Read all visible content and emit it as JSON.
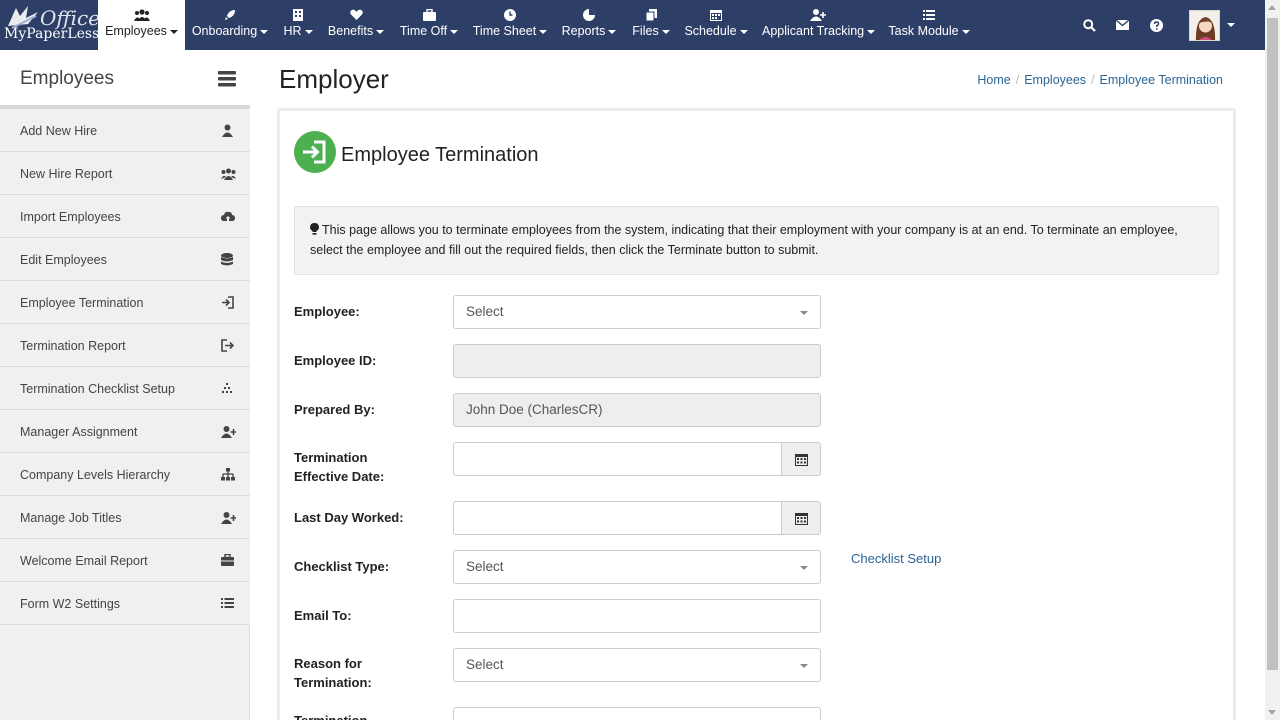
{
  "brand": {
    "line1": "Office",
    "line2": "MyPaperLess"
  },
  "nav": {
    "items": [
      {
        "label": "Employees",
        "icon": "users-icon"
      },
      {
        "label": "Onboarding",
        "icon": "rocket-icon"
      },
      {
        "label": "HR",
        "icon": "building-icon"
      },
      {
        "label": "Benefits",
        "icon": "heart-icon"
      },
      {
        "label": "Time Off",
        "icon": "briefcase-icon"
      },
      {
        "label": "Time Sheet",
        "icon": "clock-icon"
      },
      {
        "label": "Reports",
        "icon": "pie-chart-icon"
      },
      {
        "label": "Files",
        "icon": "files-icon"
      },
      {
        "label": "Schedule",
        "icon": "calendar-icon"
      },
      {
        "label": "Applicant Tracking",
        "icon": "user-plus-icon"
      },
      {
        "label": "Task Module",
        "icon": "list-icon"
      }
    ],
    "active_color": "#ffffff",
    "bar_color": "#2d3f66"
  },
  "sidebar": {
    "title": "Employees",
    "items": [
      {
        "label": "Add New Hire",
        "icon": "user-icon"
      },
      {
        "label": "New Hire Report",
        "icon": "users-icon"
      },
      {
        "label": "Import Employees",
        "icon": "cloud-upload-icon"
      },
      {
        "label": "Edit Employees",
        "icon": "database-icon"
      },
      {
        "label": "Employee Termination",
        "icon": "sign-in-icon"
      },
      {
        "label": "Termination Report",
        "icon": "sign-out-icon"
      },
      {
        "label": "Termination Checklist Setup",
        "icon": "tasks-icon"
      },
      {
        "label": "Manager Assignment",
        "icon": "user-plus-icon"
      },
      {
        "label": "Company Levels Hierarchy",
        "icon": "sitemap-icon"
      },
      {
        "label": "Manage Job Titles",
        "icon": "user-plus-icon"
      },
      {
        "label": "Welcome Email Report",
        "icon": "briefcase-icon"
      },
      {
        "label": "Form W2 Settings",
        "icon": "list-icon"
      }
    ]
  },
  "page": {
    "title": "Employer",
    "breadcrumb": [
      "Home",
      "Employees",
      "Employee Termination"
    ]
  },
  "card": {
    "title": "Employee Termination",
    "info": "This page allows you to terminate employees from the system, indicating that their employment with your company is at an end. To terminate an employee, select the employee and fill out the required fields, then click the Terminate button to submit."
  },
  "form": {
    "employee": {
      "label": "Employee:",
      "value": "Select"
    },
    "employee_id": {
      "label": "Employee ID:",
      "value": ""
    },
    "prepared_by": {
      "label": "Prepared By:",
      "value": "John Doe (CharlesCR)"
    },
    "effective_date": {
      "label_l1": "Termination",
      "label_l2": "Effective Date:",
      "value": ""
    },
    "last_day": {
      "label": "Last Day Worked:",
      "value": ""
    },
    "checklist_type": {
      "label": "Checklist Type:",
      "value": "Select",
      "link": "Checklist Setup"
    },
    "email_to": {
      "label": "Email To:",
      "value": ""
    },
    "reason": {
      "label_l1": "Reason for",
      "label_l2": "Termination:",
      "value": "Select"
    },
    "next_label": "Termination"
  },
  "colors": {
    "accent": "#2a6496",
    "card_icon": "#4caf50"
  }
}
